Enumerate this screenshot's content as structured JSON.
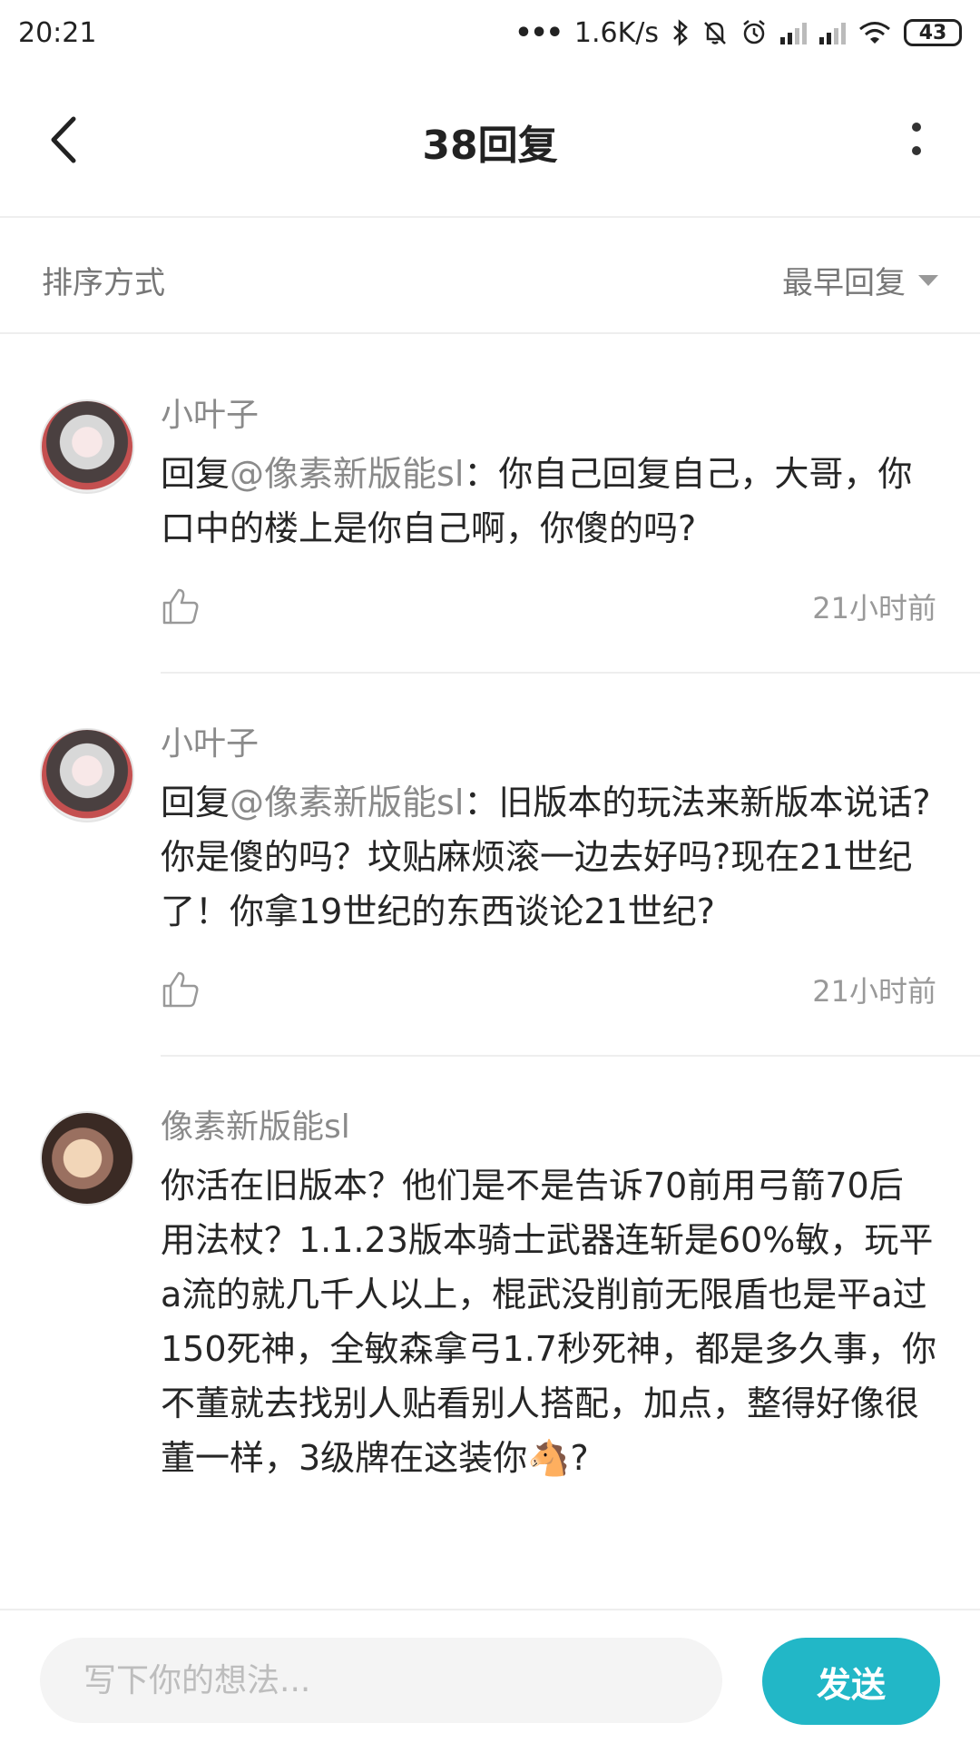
{
  "status_bar": {
    "time": "20:21",
    "network_speed": "1.6K/s",
    "battery": "43",
    "icons": [
      "dots-icon",
      "bluetooth-icon",
      "mute-bell-icon",
      "alarm-icon",
      "signal-icon",
      "signal-icon",
      "wifi-icon",
      "battery-icon"
    ]
  },
  "header": {
    "title": "38回复",
    "back_icon": "back-arrow-icon",
    "more_icon": "more-vertical-icon"
  },
  "sort": {
    "label": "排序方式",
    "selected": "最早回复"
  },
  "comments": [
    {
      "username": "小叶子",
      "reply_prefix": "回复",
      "mention": "@像素新版能sl",
      "text": "：你自己回复自己，大哥，你口中的楼上是你自己啊，你傻的吗?",
      "time": "21小时前"
    },
    {
      "username": "小叶子",
      "reply_prefix": "回复",
      "mention": "@像素新版能sl",
      "text": "：旧版本的玩法来新版本说话?你是傻的吗？坟贴麻烦滚一边去好吗?现在21世纪了！你拿19世纪的东西谈论21世纪?",
      "time": "21小时前"
    },
    {
      "username": "像素新版能sl",
      "reply_prefix": "",
      "mention": "",
      "text": "你活在旧版本？他们是不是告诉70前用弓箭70后用法杖？1.1.23版本骑士武器连斩是60%敏，玩平a流的就几千人以上，棍武没削前无限盾也是平a过150死神，全敏森拿弓1.7秒死神，都是多久事，你不董就去找别人贴看别人搭配，加点，整得好像很董一样，3级牌在这装你🐴?",
      "time": ""
    }
  ],
  "composer": {
    "placeholder": "写下你的想法...",
    "value": "",
    "send_label": "发送"
  },
  "colors": {
    "accent": "#22b7c7",
    "username": "#8a8a8a",
    "text": "#262626"
  }
}
